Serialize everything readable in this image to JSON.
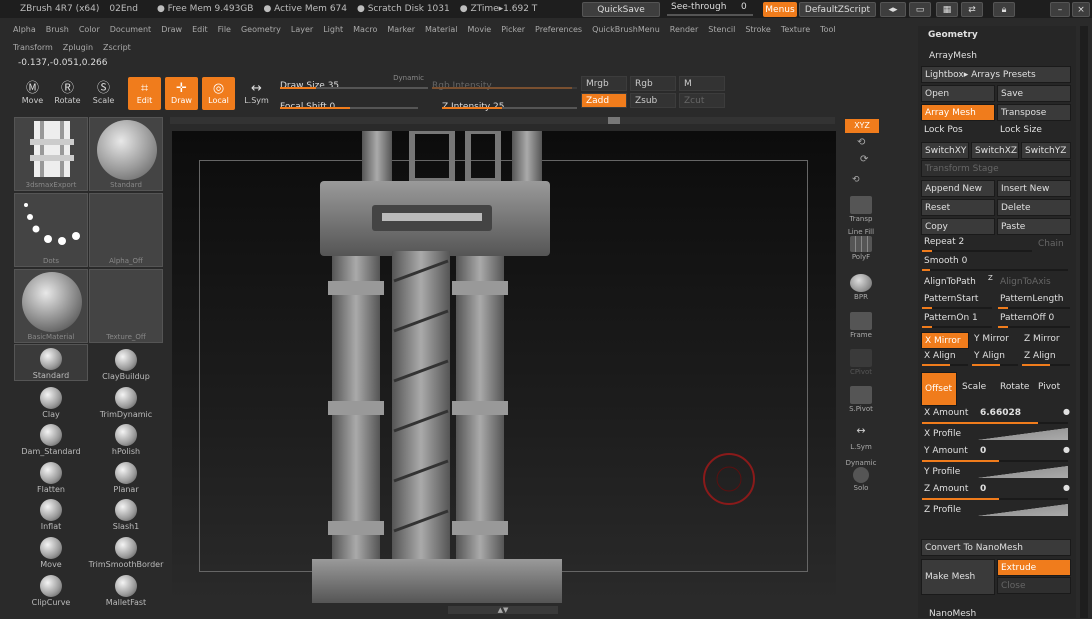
{
  "titlebar": {
    "app": "ZBrush 4R7 (x64)",
    "build": "02End",
    "free_mem": "● Free Mem 9.493GB",
    "active_mem": "● Active Mem 674",
    "scratch": "● Scratch Disk 1031",
    "ztime": "● ZTime▸1.692 T",
    "quicksave": "QuickSave",
    "seethrough": "See-through",
    "seethrough_value": "0",
    "menus": "Menus",
    "defaultzscript": "DefaultZScript"
  },
  "menu": {
    "row1": [
      "Alpha",
      "Brush",
      "Color",
      "Document",
      "Draw",
      "Edit",
      "File",
      "Geometry",
      "Layer",
      "Light",
      "Macro",
      "Marker",
      "Material",
      "Movie",
      "Picker",
      "Preferences",
      "QuickBrushMenu",
      "Render",
      "Stencil",
      "Stroke",
      "Texture",
      "Tool"
    ],
    "row2": [
      "Transform",
      "Zplugin",
      "Zscript"
    ]
  },
  "coords": "-0.137,-0.051,0.266",
  "toolbar": {
    "move": "Move",
    "rotate": "Rotate",
    "scale": "Scale",
    "edit": "Edit",
    "draw": "Draw",
    "local": "Local",
    "lsym": "L.Sym",
    "draw_size": "Draw Size 35",
    "dynamic": "Dynamic",
    "rgb_intensity": "Rgb Intensity",
    "focal_shift": "Focal Shift 0",
    "z_intensity": "Z Intensity 25",
    "mrgb": "Mrgb",
    "rgb": "Rgb",
    "m": "M",
    "zadd": "Zadd",
    "zsub": "Zsub",
    "zcut": "Zcut"
  },
  "left": {
    "thumbs": [
      {
        "label": "3dsmaxExport"
      },
      {
        "label": "Standard"
      },
      {
        "label": "Dots"
      },
      {
        "label": "Alpha_Off"
      },
      {
        "label": "BasicMaterial"
      },
      {
        "label": "Texture_Off"
      }
    ],
    "brushes": [
      "Standard",
      "ClayBuildup",
      "Clay",
      "TrimDynamic",
      "Dam_Standard",
      "hPolish",
      "Flatten",
      "Planar",
      "Inflat",
      "Slash1",
      "Move",
      "TrimSmoothBorder",
      "ClipCurve",
      "MalletFast"
    ]
  },
  "rightbar": {
    "xyz": "XYZ",
    "transp": "Transp",
    "linefill": "Line Fill",
    "polyf": "PolyF",
    "bpr": "BPR",
    "frame": "Frame",
    "cpivot": "CPivot",
    "spivot": "S.Pivot",
    "lsym": "L.Sym",
    "dynamic": "Dynamic",
    "solo": "Solo"
  },
  "panel": {
    "geometry": "Geometry",
    "arraymesh": "ArrayMesh",
    "lightbox": "Lightbox▸ Arrays Presets",
    "open": "Open",
    "save": "Save",
    "array_mesh": "Array Mesh",
    "transpose": "Transpose",
    "lock_pos": "Lock Pos",
    "lock_size": "Lock Size",
    "switchxy": "SwitchXY",
    "switchxz": "SwitchXZ",
    "switchyz": "SwitchYZ",
    "transform_stage": "Transform Stage",
    "append_new": "Append New",
    "insert_new": "Insert New",
    "reset": "Reset",
    "delete": "Delete",
    "copy": "Copy",
    "paste": "Paste",
    "repeat": "Repeat 2",
    "chain": "Chain",
    "smooth": "Smooth 0",
    "align_to_path": "AlignToPath",
    "align_to_path_z": "Z",
    "align_to_axis": "AlignToAxis",
    "pattern_start": "PatternStart",
    "pattern_length": "PatternLength",
    "pattern_on": "PatternOn 1",
    "pattern_off": "PatternOff 0",
    "x_mirror": "X Mirror",
    "y_mirror": "Y Mirror",
    "z_mirror": "Z Mirror",
    "x_align": "X Align",
    "y_align": "Y Align",
    "z_align": "Z Align",
    "offset": "Offset",
    "scale": "Scale",
    "rotate": "Rotate",
    "pivot": "Pivot",
    "x_amount": "X Amount",
    "x_amount_value": "6.66028",
    "x_profile": "X Profile",
    "y_amount": "Y Amount",
    "y_amount_value": "0",
    "y_profile": "Y Profile",
    "z_amount": "Z Amount",
    "z_amount_value": "0",
    "z_profile": "Z Profile",
    "convert": "Convert To NanoMesh",
    "make_mesh": "Make Mesh",
    "extrude": "Extrude",
    "close": "Close",
    "nanomesh": "NanoMesh"
  },
  "colors": {
    "accent": "#f07c1c",
    "bg": "#2a2a2a",
    "panel": "#262626"
  }
}
